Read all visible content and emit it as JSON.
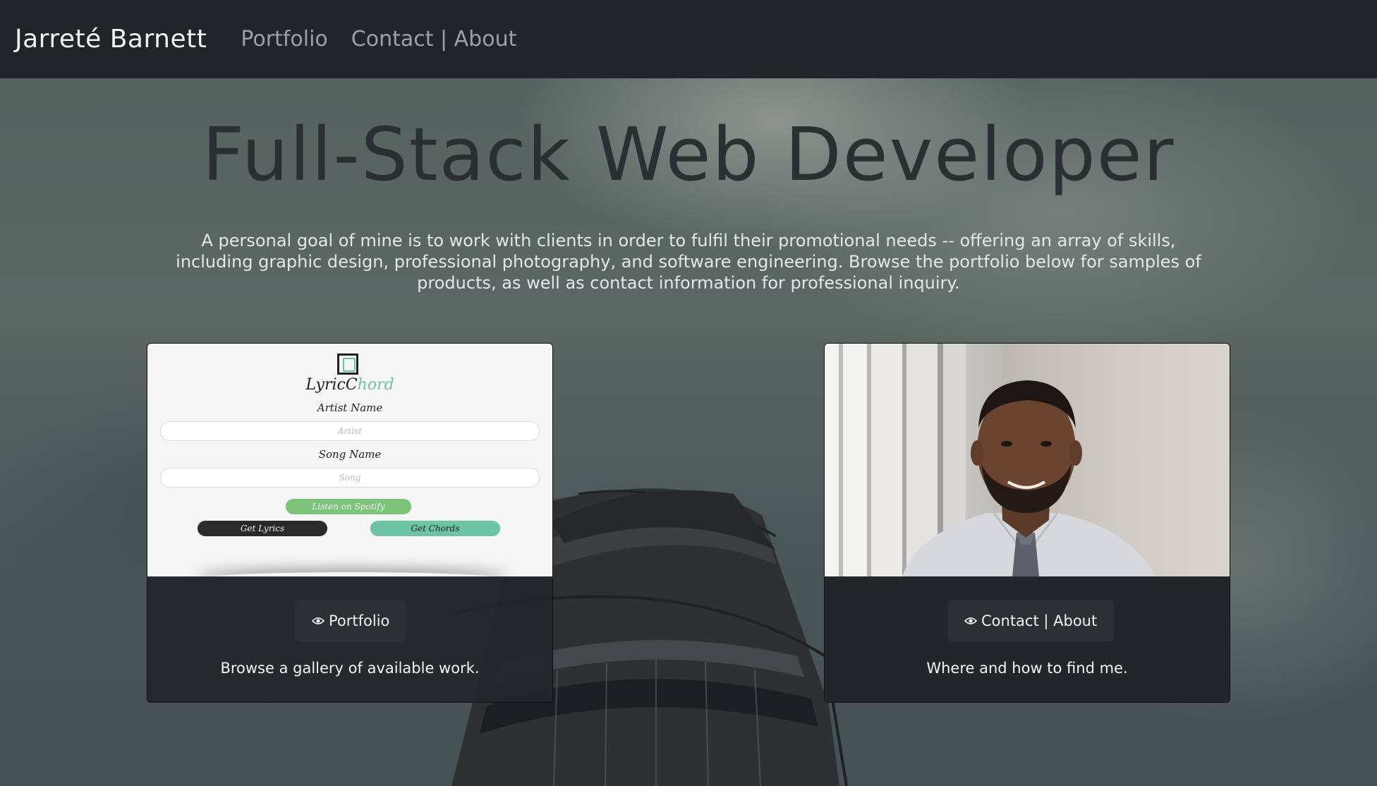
{
  "navbar": {
    "brand": "Jarreté Barnett",
    "links": [
      {
        "label": "Portfolio"
      },
      {
        "label": "Contact | About"
      }
    ],
    "background": "#212529"
  },
  "hero": {
    "title": "Full-Stack Web Developer",
    "description": "A personal goal of mine is to work with clients in order to fulfil their promotional needs -- offering an array of skills, including graphic design, professional photography, and software engineering. Browse the portfolio below for samples of products, as well as contact information for professional inquiry."
  },
  "cards": [
    {
      "image_kind": "LyricChord app screenshot",
      "button_icon": "eye-icon",
      "button_label": "Portfolio",
      "text": "Browse a gallery of available work.",
      "mockup": {
        "logo_text_a": "LyricC",
        "logo_text_b": "hord",
        "artist_label": "Artist Name",
        "artist_placeholder": "Artist",
        "song_label": "Song Name",
        "song_placeholder": "Song",
        "spotify_button": "Listen on Spotify",
        "lyrics_button": "Get Lyrics",
        "chords_button": "Get Chords"
      }
    },
    {
      "image_kind": "portrait photo",
      "button_icon": "eye-icon",
      "button_label": "Contact | About",
      "text": "Where and how to find me."
    }
  ],
  "colors": {
    "accent_green": "#6cc4a4",
    "spotify_green": "#7cc47c",
    "card_bg": "#22262a"
  }
}
